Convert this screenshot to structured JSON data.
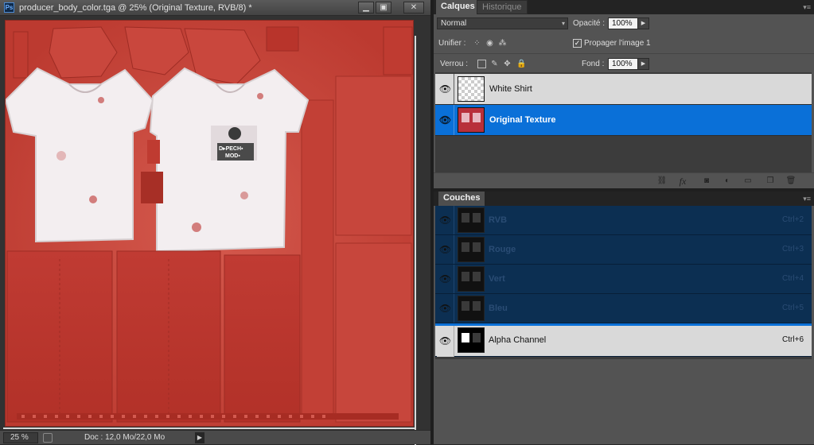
{
  "document": {
    "title": "producer_body_color.tga @ 25% (Original Texture, RVB/8) *",
    "app_icon": "Ps",
    "window_buttons": {
      "minimize": "▁",
      "maximize": "▣",
      "close": "✕"
    },
    "status": {
      "zoom": "25 %",
      "doc_size": "Doc : 12,0 Mo/22,0 Mo",
      "arrow": "▶"
    }
  },
  "layers_panel": {
    "tabs": [
      {
        "label": "Calques",
        "active": true
      },
      {
        "label": "Historique",
        "active": false
      }
    ],
    "blend_mode": "Normal",
    "opacity_label": "Opacité :",
    "opacity_value": "100%",
    "unify_label": "Unifier :",
    "propagate_label": "Propager l'image 1",
    "propagate_checked": "✓",
    "lock_label": "Verrou :",
    "fill_label": "Fond :",
    "fill_value": "100%",
    "layers": [
      {
        "name": "White Shirt",
        "visible_icon": "👁"
      },
      {
        "name": "Original Texture",
        "visible_icon": "👁",
        "selected": true
      }
    ],
    "bottom_icons": [
      "link-icon",
      "fx-icon",
      "mask-icon",
      "adjustment-icon",
      "folder-icon",
      "new-layer-icon",
      "trash-icon"
    ],
    "fx_label": "fx"
  },
  "channels_panel": {
    "tab": "Couches",
    "channels": [
      {
        "name": "RVB",
        "shortcut": "Ctrl+2"
      },
      {
        "name": "Rouge",
        "shortcut": "Ctrl+3"
      },
      {
        "name": "Vert",
        "shortcut": "Ctrl+4"
      },
      {
        "name": "Bleu",
        "shortcut": "Ctrl+5"
      },
      {
        "name": "Alpha Channel",
        "shortcut": "Ctrl+6"
      }
    ]
  },
  "colors": {
    "selection_blue": "#0a70d8",
    "texture_red": "#c8453b",
    "panel_gray": "#535353"
  }
}
